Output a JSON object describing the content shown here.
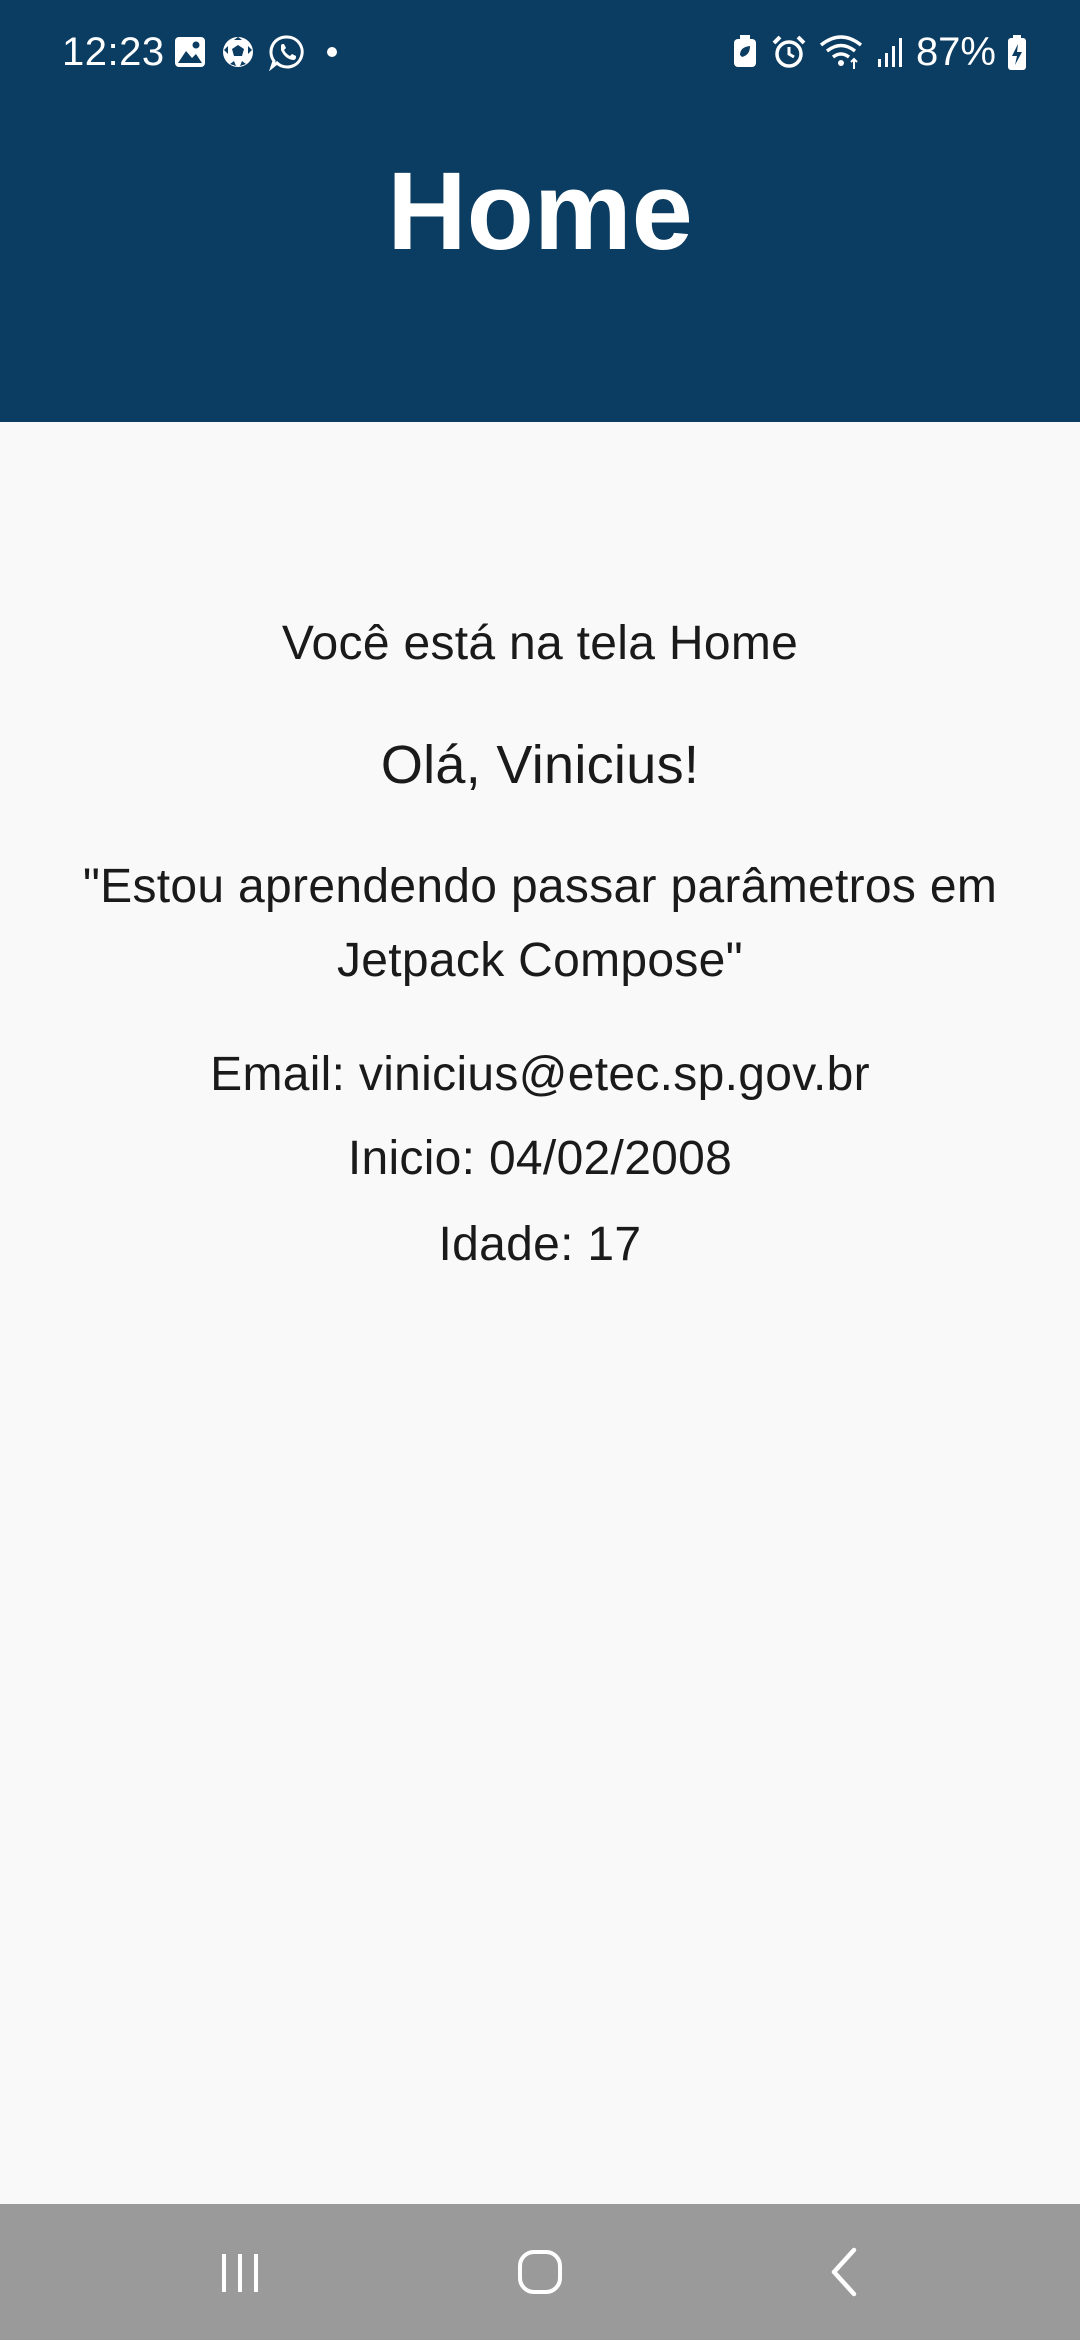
{
  "status_bar": {
    "time": "12:23",
    "left_icons": [
      "gallery-icon",
      "soccer-ball-icon",
      "whatsapp-icon",
      "dot-icon"
    ],
    "right_icons": [
      "battery-saver-icon",
      "alarm-icon",
      "wifi-icon",
      "signal-icon",
      "battery-charging-icon"
    ],
    "battery": "87%"
  },
  "header": {
    "title": "Home",
    "background": "#0b3c61"
  },
  "content": {
    "screen_text": "Você está na tela Home",
    "greeting": "Olá, Vinicius!",
    "quote": "\"Estou aprendendo passar parâmetros em Jetpack Compose\"",
    "email": "Email: vinicius@etec.sp.gov.br",
    "start": "Inicio: 04/02/2008",
    "age": "Idade: 17"
  },
  "nav_bar": {
    "buttons": [
      "recents-icon",
      "home-icon",
      "back-icon"
    ],
    "background": "#9a9a9a"
  }
}
